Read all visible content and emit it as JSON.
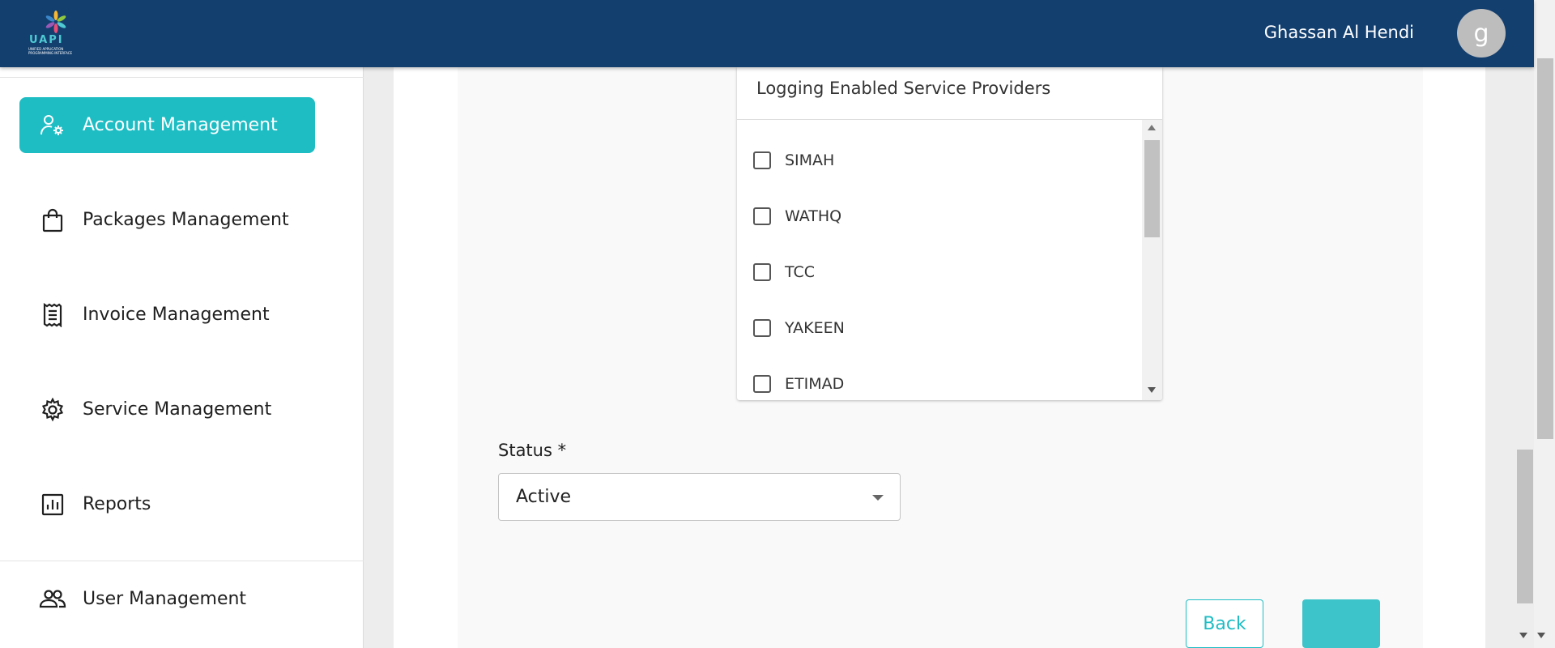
{
  "header": {
    "logo": {
      "word": "UAPI",
      "subtitle": "Unified Application Programming Interface"
    },
    "user_name": "Ghassan Al Hendi",
    "avatar_initial": "g",
    "background_color": "#133f6f"
  },
  "sidebar": {
    "items": [
      {
        "label": "Account Management",
        "icon": "account-gear-icon",
        "active": true
      },
      {
        "label": "Packages Management",
        "icon": "shopping-bag-icon",
        "active": false
      },
      {
        "label": "Invoice Management",
        "icon": "receipt-icon",
        "active": false
      },
      {
        "label": "Service Management",
        "icon": "gear-icon",
        "active": false
      },
      {
        "label": "Reports",
        "icon": "bar-chart-icon",
        "active": false
      },
      {
        "label": "User Management",
        "icon": "users-icon",
        "active": false
      }
    ],
    "active_color": "#1ebdc4"
  },
  "form": {
    "providers_title": "Logging Enabled Service Providers",
    "providers": [
      {
        "label": "SIMAH",
        "checked": false
      },
      {
        "label": "WATHQ",
        "checked": false
      },
      {
        "label": "TCC",
        "checked": false
      },
      {
        "label": "YAKEEN",
        "checked": false
      },
      {
        "label": "ETIMAD",
        "checked": false
      }
    ],
    "status_label": "Status *",
    "status_value": "Active",
    "back_label": "Back",
    "submit_label": "",
    "accent_color": "#1ebdc4"
  }
}
